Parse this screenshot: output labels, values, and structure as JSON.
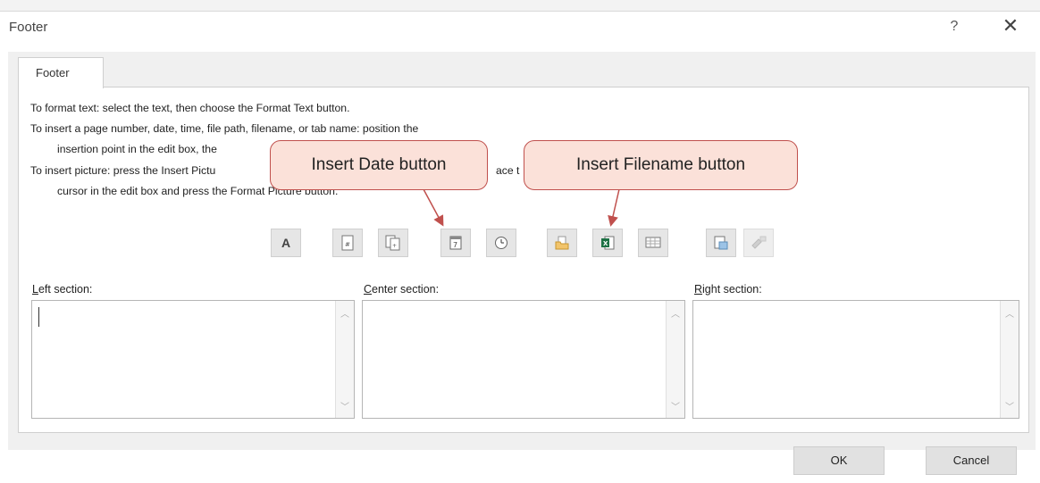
{
  "window": {
    "title": "Footer",
    "help_glyph": "?",
    "close_glyph": "✕"
  },
  "tabs": [
    {
      "label": "Footer",
      "selected": true
    }
  ],
  "instructions": {
    "line1": "To format text:  select the text, then choose the Format Text button.",
    "line2": "To insert a page number, date, time, file path, filename, or tab name:  position the",
    "line3": "insertion point in the edit box, the",
    "line4a": "To insert picture: press the Insert Pictu",
    "line4b": "ace t",
    "line5": "cursor in the edit box and press the Format Picture button."
  },
  "toolbar": [
    {
      "name": "format-text",
      "icon": "format-text-icon",
      "glyph": "A"
    },
    {
      "name": "insert-page-number",
      "icon": "page-number-icon"
    },
    {
      "name": "insert-number-of-pages",
      "icon": "number-of-pages-icon"
    },
    {
      "name": "insert-date",
      "icon": "calendar-icon"
    },
    {
      "name": "insert-time",
      "icon": "clock-icon"
    },
    {
      "name": "insert-file-path",
      "icon": "folder-icon"
    },
    {
      "name": "insert-filename",
      "icon": "excel-file-icon"
    },
    {
      "name": "insert-sheet-name",
      "icon": "sheet-icon"
    },
    {
      "name": "insert-picture",
      "icon": "picture-icon"
    },
    {
      "name": "format-picture",
      "icon": "format-picture-icon",
      "disabled": true
    }
  ],
  "sections": {
    "left": {
      "accel": "L",
      "rest": "eft section:"
    },
    "center": {
      "accel": "C",
      "rest": "enter section:"
    },
    "right": {
      "accel": "R",
      "rest": "ight section:"
    }
  },
  "buttons": {
    "ok": "OK",
    "cancel": "Cancel"
  },
  "callouts": {
    "date": "Insert Date button",
    "filename": "Insert Filename button"
  },
  "colors": {
    "callout_fill": "#fbe1d9",
    "callout_border": "#c0504d",
    "excel_green": "#1e7145"
  }
}
